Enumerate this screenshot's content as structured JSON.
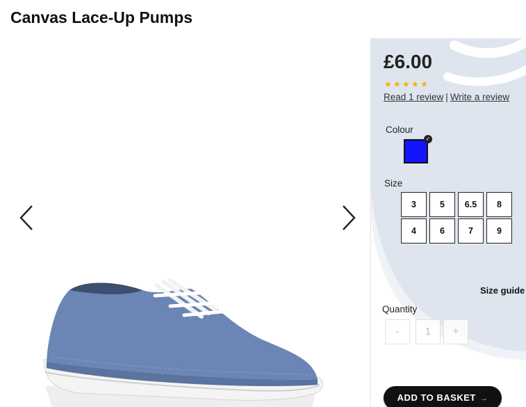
{
  "product": {
    "title": "Canvas Lace-Up Pumps"
  },
  "gallery": {
    "prev_icon": "chevron-left-icon",
    "next_icon": "chevron-right-icon"
  },
  "panel": {
    "price": "£6.00",
    "rating": 5,
    "read_reviews": "Read 1 review",
    "separator": "|",
    "write_review": "Write a review",
    "colour_label": "Colour",
    "colour": {
      "value": "#1414ff",
      "selected": true
    },
    "size_label": "Size",
    "sizes": [
      "3",
      "5",
      "6.5",
      "8",
      "4",
      "6",
      "7",
      "9"
    ],
    "size_guide": "Size guide",
    "quantity_label": "Quantity",
    "quantity": {
      "minus": "-",
      "value": "1",
      "plus": "+"
    },
    "add_to_basket": "ADD TO BASKET"
  }
}
